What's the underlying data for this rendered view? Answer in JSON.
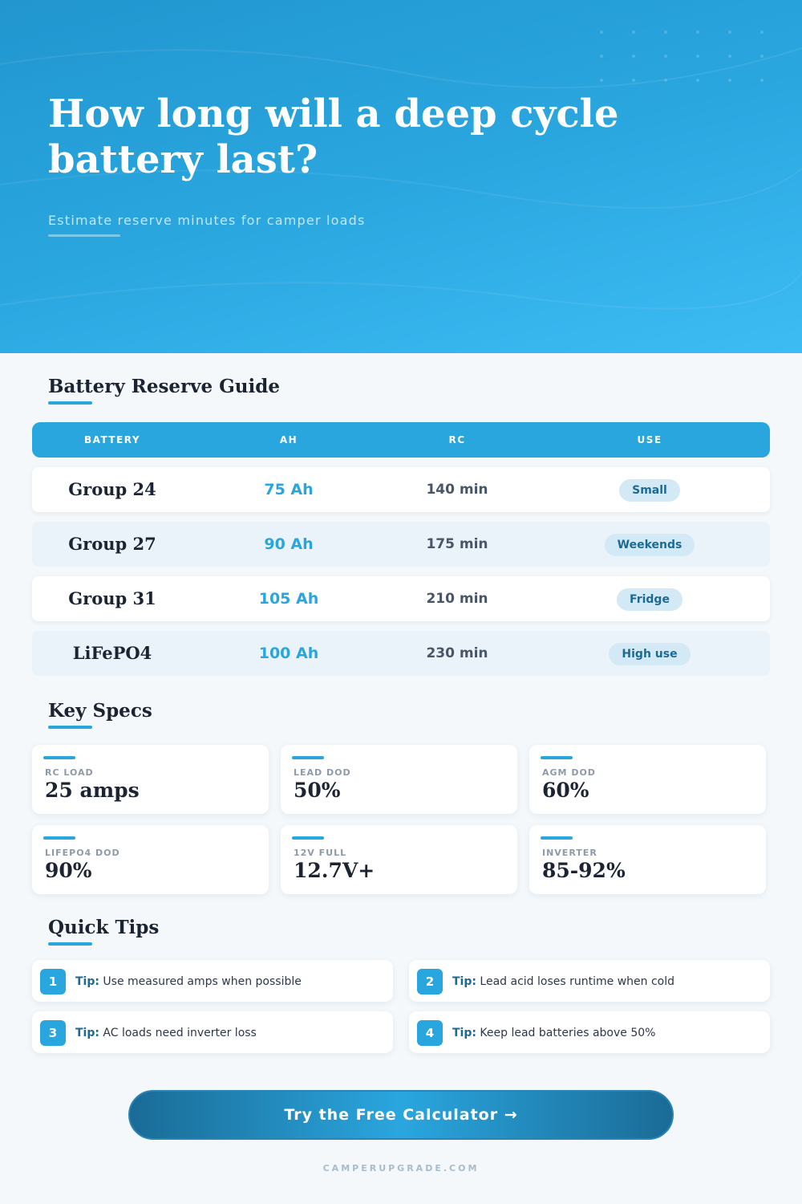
{
  "hero": {
    "title": "How long will a deep cycle battery last?",
    "subtitle": "Estimate reserve minutes for camper loads"
  },
  "guide": {
    "title": "Battery Reserve Guide",
    "columns": [
      "BATTERY",
      "AH",
      "RC",
      "USE"
    ],
    "rows": [
      {
        "battery": "Group 24",
        "ah": "75 Ah",
        "rc": "140 min",
        "use": "Small"
      },
      {
        "battery": "Group 27",
        "ah": "90 Ah",
        "rc": "175 min",
        "use": "Weekends"
      },
      {
        "battery": "Group 31",
        "ah": "105 Ah",
        "rc": "210 min",
        "use": "Fridge"
      },
      {
        "battery": "LiFePO4",
        "ah": "100 Ah",
        "rc": "230 min",
        "use": "High use"
      }
    ]
  },
  "specs": {
    "title": "Key Specs",
    "items": [
      {
        "label": "RC LOAD",
        "value": "25 amps"
      },
      {
        "label": "LEAD DOD",
        "value": "50%"
      },
      {
        "label": "AGM DOD",
        "value": "60%"
      },
      {
        "label": "LIFEPO4 DOD",
        "value": "90%"
      },
      {
        "label": "12V FULL",
        "value": "12.7V+"
      },
      {
        "label": "INVERTER",
        "value": "85-92%"
      }
    ]
  },
  "tips": {
    "title": "Quick Tips",
    "prefix": "Tip:",
    "items": [
      {
        "num": "1",
        "text": "Use measured amps when possible"
      },
      {
        "num": "2",
        "text": "Lead acid loses runtime when cold"
      },
      {
        "num": "3",
        "text": "AC loads need inverter loss"
      },
      {
        "num": "4",
        "text": "Keep lead batteries above 50%"
      }
    ]
  },
  "cta": {
    "label": "Try the Free Calculator →"
  },
  "footer": {
    "site": "CAMPERUPGRADE.COM"
  },
  "colors": {
    "accent": "#2aa6df",
    "hero_top": "#2196cf",
    "hero_bottom": "#3dbcf4",
    "heading": "#1c2433",
    "pill_bg": "#d3e9f6",
    "pill_text": "#1c6a94"
  }
}
